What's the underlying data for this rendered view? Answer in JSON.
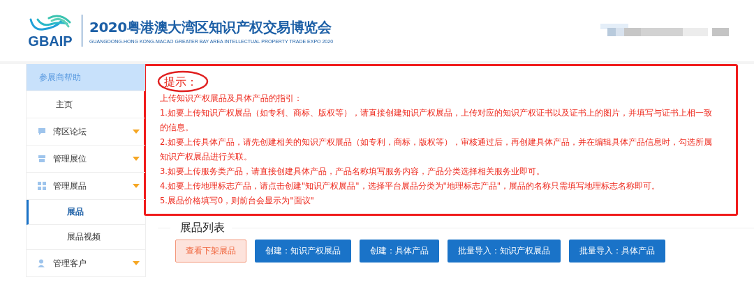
{
  "header": {
    "logo_text": "GBAIP",
    "title": "2020粤港澳大湾区知识产权交易博览会",
    "subtitle": "GUANGDONG-HONG KONG-MACAO GREATER BAY AREA INTELLECTUAL PROPERTY TRADE EXPO 2020"
  },
  "sidebar": {
    "items": [
      {
        "kind": "header",
        "label": "参展商帮助",
        "selected": false
      },
      {
        "kind": "item",
        "label": "主页",
        "selected": false
      },
      {
        "kind": "group",
        "label": "湾区论坛",
        "selected": false
      },
      {
        "kind": "group",
        "label": "管理展位",
        "selected": false
      },
      {
        "kind": "group",
        "label": "管理展品",
        "selected": false
      },
      {
        "kind": "subitem",
        "label": "展品",
        "selected": true
      },
      {
        "kind": "subitem",
        "label": "展品视频",
        "selected": false
      },
      {
        "kind": "group",
        "label": "管理客户",
        "selected": false
      }
    ]
  },
  "notice": {
    "title": "提示：",
    "intro": "上传知识产权展品及具体产品的指引：",
    "lines": [
      "1.如要上传知识产权展品（如专利、商标、版权等），请直接创建知识产权展品，上传对应的知识产权证书以及证书上的图片，并填写与证书上相一致的信息。",
      "2.如要上传具体产品，请先创建相关的知识产权展品（如专利，商标，版权等），审核通过后，再创建具体产品，并在编辑具体产品信息时，勾选所属知识产权展品进行关联。",
      "3.如要上传服务类产品，请直接创建具体产品，产品名称填写服务内容，产品分类选择相关服务业即可。",
      "4.如要上传地理标志产品，请点击创建\"知识产权展品\"，选择平台展品分类为\"地理标志产品\"，展品的名称只需填写地理标志名称即可。",
      "5.展品价格填写0，则前台会显示为\"面议\""
    ]
  },
  "list": {
    "title": "展品列表",
    "buttons": [
      {
        "kind": "secondary",
        "label": "查看下架展品"
      },
      {
        "kind": "primary",
        "label": "创建：知识产权展品"
      },
      {
        "kind": "primary",
        "label": "创建：具体产品"
      },
      {
        "kind": "primary",
        "label": "批量导入：知识产权展品"
      },
      {
        "kind": "primary",
        "label": "批量导入：具体产品"
      }
    ]
  }
}
